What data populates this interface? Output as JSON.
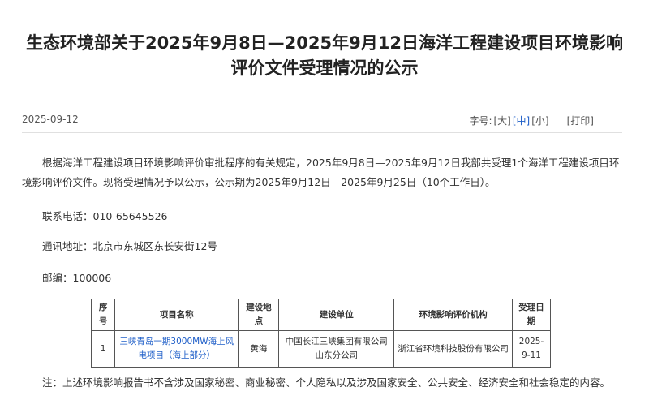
{
  "article": {
    "title": "生态环境部关于2025年9月8日—2025年9月12日海洋工程建设项目环境影响评价文件受理情况的公示",
    "date": "2025-09-12",
    "font_size_label": "字号:",
    "font_size_large": "[大]",
    "font_size_medium": "[中]",
    "font_size_small": "[小]",
    "print": "[打印]",
    "intro": "根据海洋工程建设项目环境影响评价审批程序的有关规定，2025年9月8日—2025年9月12日我部共受理1个海洋工程建设项目环境影响评价文件。现将受理情况予以公示，公示期为2025年9月12日—2025年9月25日（10个工作日）。",
    "phone": "联系电话：010-65645526",
    "address": "通讯地址：北京市东城区东长安街12号",
    "postcode": "邮编：100006",
    "note": "注：上述环境影响报告书不含涉及国家秘密、商业秘密、个人隐私以及涉及国家安全、公共安全、经济安全和社会稳定的内容。"
  },
  "table": {
    "headers": [
      "序号",
      "项目名称",
      "建设地点",
      "建设单位",
      "环境影响评价机构",
      "受理日期"
    ],
    "rows": [
      [
        "1",
        "三峡青岛一期3000MW海上风电项目（海上部分）",
        "黄海",
        "中国长江三峡集团有限公司山东分公司",
        "浙江省环境科技股份有限公司",
        "2025-9-11"
      ]
    ]
  },
  "colors": {
    "link": "#1e5ec8",
    "text": "#333333"
  }
}
